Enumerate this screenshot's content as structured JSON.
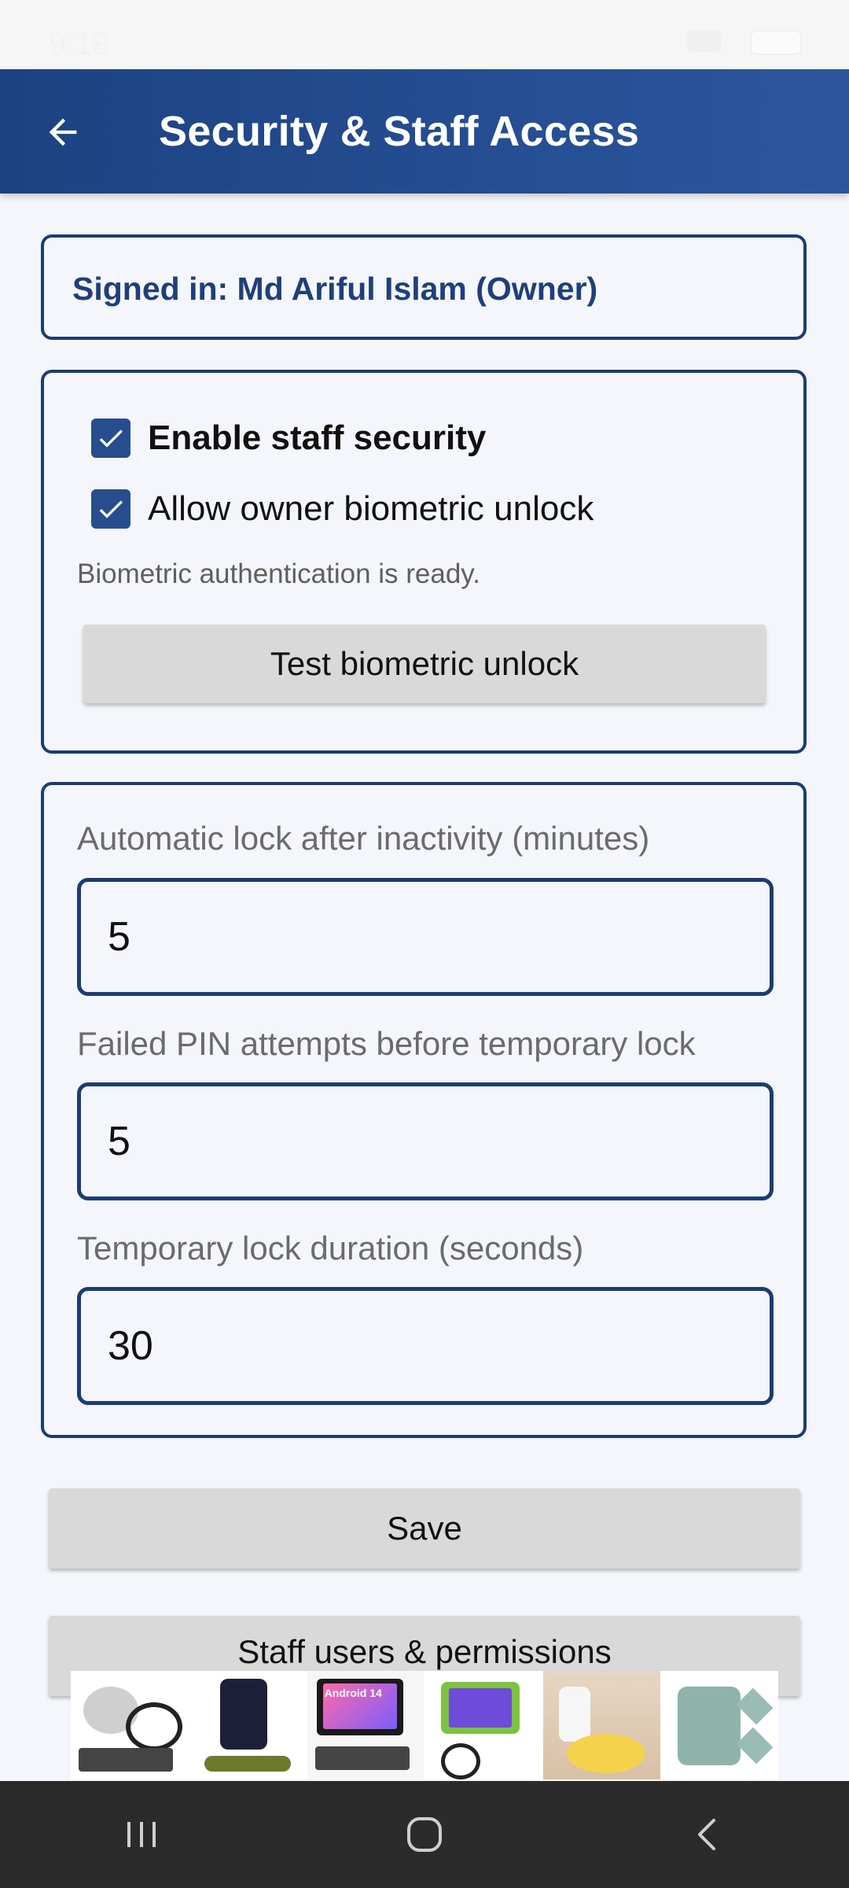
{
  "status_bar": {
    "time": "9:18"
  },
  "header": {
    "title": "Security & Staff Access"
  },
  "account": {
    "signed_in_text": "Signed in: Md Ariful Islam (Owner)"
  },
  "security": {
    "enable_staff_security": {
      "label": "Enable staff security",
      "checked": true
    },
    "allow_biometric": {
      "label": "Allow owner biometric unlock",
      "checked": true
    },
    "biometric_status": "Biometric authentication is ready.",
    "test_button_label": "Test biometric unlock"
  },
  "settings": {
    "auto_lock": {
      "label": "Automatic lock after inactivity (minutes)",
      "value": "5"
    },
    "failed_attempts": {
      "label": "Failed PIN attempts before temporary lock",
      "value": "5"
    },
    "lock_duration": {
      "label": "Temporary lock duration (seconds)",
      "value": "30"
    }
  },
  "actions": {
    "save_label": "Save",
    "staff_users_label": "Staff users & permissions"
  },
  "ad": {
    "items": [
      "product-grinder",
      "product-mandoline",
      "product-tablet-android",
      "product-tablet-kids",
      "product-potato-slicer",
      "product-drum-grater"
    ],
    "tablet_text": "Android 14"
  },
  "theme": {
    "primary": "#1c3c72",
    "header": "#24498a",
    "checkbox": "#274d8e"
  }
}
